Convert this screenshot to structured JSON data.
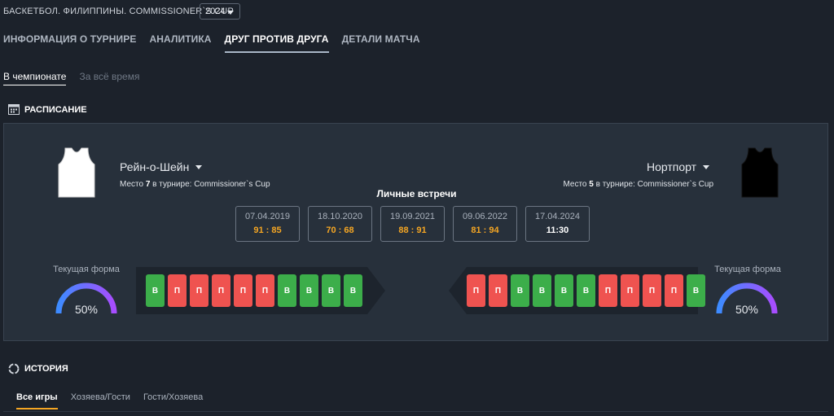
{
  "header": {
    "title": "БАСКЕТБОЛ. ФИЛИППИНЫ. COMMISSIONER`S CUP",
    "year": "2024"
  },
  "main_tabs": [
    {
      "label": "ИНФОРМАЦИЯ О ТУРНИРЕ",
      "active": false
    },
    {
      "label": "АНАЛИТИКА",
      "active": false
    },
    {
      "label": "ДРУГ ПРОТИВ ДРУГА",
      "active": true
    },
    {
      "label": "ДЕТАЛИ МАТЧА",
      "active": false
    }
  ],
  "sub_tabs": [
    {
      "label": "В чемпионате",
      "active": true
    },
    {
      "label": "За всё время",
      "active": false
    }
  ],
  "schedule": {
    "title": "РАСПИСАНИЕ",
    "home": {
      "name": "Рейн-о-Шейн",
      "place_prefix": "Место",
      "place": "7",
      "place_suffix": "в турнире: Commissioner`s Cup",
      "jersey_color": "#ffffff"
    },
    "away": {
      "name": "Нортпорт",
      "place_prefix": "Место",
      "place": "5",
      "place_suffix": "в турнире: Commissioner`s Cup",
      "jersey_color": "#000000"
    },
    "h2h_title": "Личные встречи",
    "meetings": [
      {
        "date": "07.04.2019",
        "score": "91 : 85"
      },
      {
        "date": "18.10.2020",
        "score": "70 : 68"
      },
      {
        "date": "19.09.2021",
        "score": "88 : 91"
      },
      {
        "date": "09.06.2022",
        "score": "81 : 94"
      },
      {
        "date": "17.04.2024",
        "score": "11:30"
      }
    ],
    "form_label": "Текущая форма",
    "home_form": {
      "percent": "50%",
      "value": 0.5,
      "results": [
        "В",
        "П",
        "П",
        "П",
        "П",
        "П",
        "В",
        "В",
        "В",
        "В"
      ]
    },
    "away_form": {
      "percent": "50%",
      "value": 0.5,
      "results": [
        "П",
        "П",
        "В",
        "В",
        "В",
        "В",
        "П",
        "П",
        "П",
        "П",
        "В"
      ]
    }
  },
  "history": {
    "title": "ИСТОРИЯ",
    "tabs": [
      {
        "label": "Все игры",
        "active": true
      },
      {
        "label": "Хозяева/Гости",
        "active": false
      },
      {
        "label": "Гости/Хозяева",
        "active": false
      }
    ]
  },
  "colors": {
    "win": "#3cae4a",
    "loss": "#ef5350",
    "score": "#f5a623",
    "accent_tab": "#f5a623"
  }
}
